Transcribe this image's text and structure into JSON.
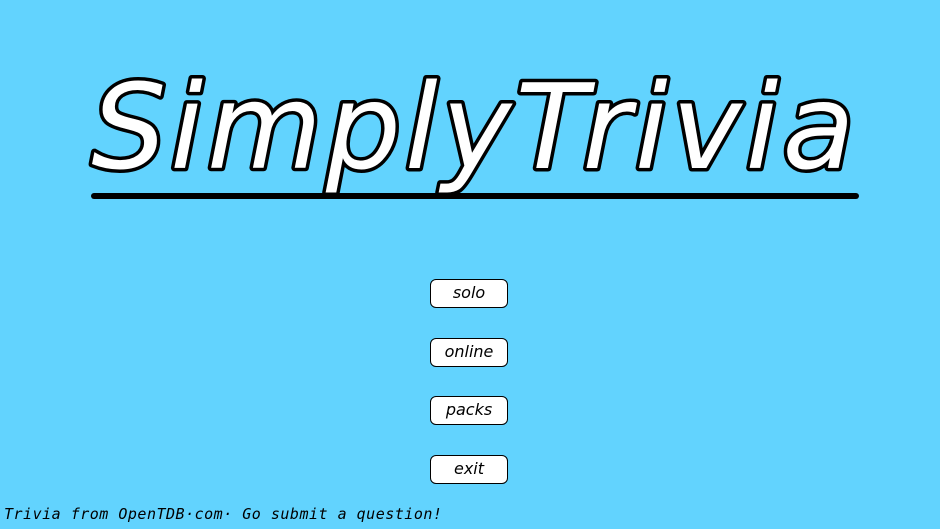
{
  "app": {
    "title": "SimplyTrivia",
    "colors": {
      "background": "#62d3fe",
      "title_fill": "#ffffff",
      "title_stroke": "#000000",
      "button_fill": "#ffffff",
      "button_border": "#000000"
    }
  },
  "menu": {
    "items": [
      {
        "label": "solo"
      },
      {
        "label": "online"
      },
      {
        "label": "packs"
      },
      {
        "label": "exit"
      }
    ]
  },
  "footer": {
    "text": "Trivia from OpenTDB·com· Go submit a question!"
  }
}
